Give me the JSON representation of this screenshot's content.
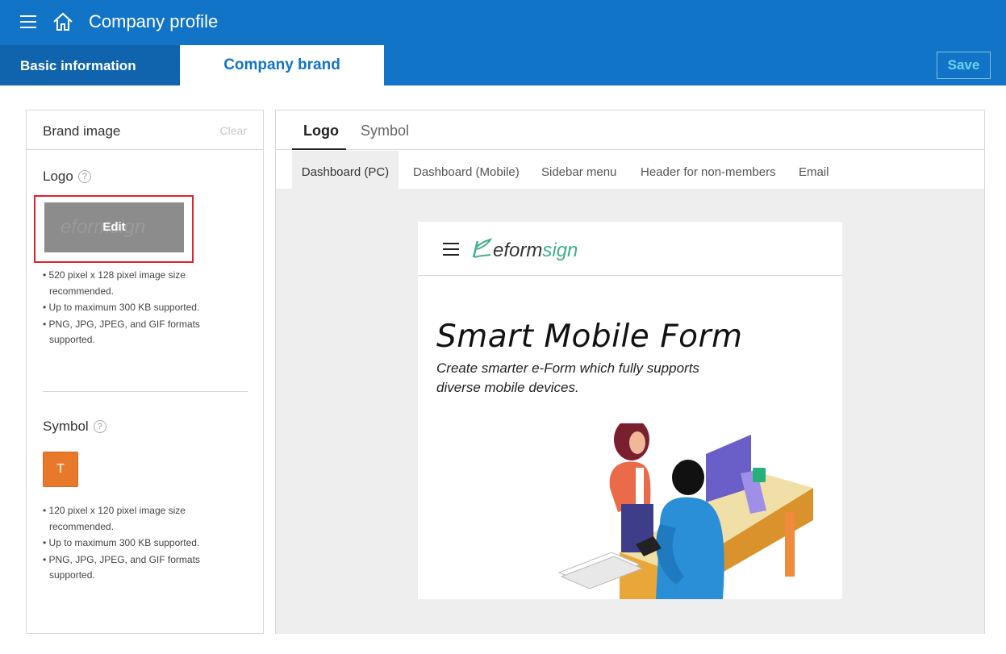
{
  "header": {
    "title": "Company profile"
  },
  "tabs": {
    "basic": "Basic information",
    "brand": "Company brand",
    "save": "Save"
  },
  "brand_panel": {
    "title": "Brand image",
    "clear": "Clear",
    "logo": {
      "label": "Logo",
      "help": "?",
      "edit": "Edit",
      "ghost_logo_text": "eformsign",
      "notes": [
        "• 520 pixel x 128 pixel image size recommended.",
        "• Up to maximum 300 KB supported.",
        "• PNG, JPG, JPEG, and GIF formats supported."
      ]
    },
    "symbol": {
      "label": "Symbol",
      "help": "?",
      "letter": "T",
      "notes": [
        "• 120 pixel x 120 pixel image size recommended.",
        "• Up to maximum 300 KB supported.",
        "• PNG, JPG, JPEG, and GIF formats supported."
      ]
    }
  },
  "preview_panel": {
    "tabs": [
      "Logo",
      "Symbol"
    ],
    "subtabs": [
      "Dashboard (PC)",
      "Dashboard (Mobile)",
      "Sidebar menu",
      "Header for non-members",
      "Email"
    ],
    "preview": {
      "logo_part1": "eform",
      "logo_part2": "sign",
      "headline": "Smart Mobile Form",
      "subline": "Create smarter e-Form which fully supports diverse mobile devices."
    }
  },
  "colors": {
    "primary": "#1274c6",
    "tab_dark": "#0f64ad",
    "highlight_border": "#e0202a",
    "symbol_bg": "#e8792b",
    "brand_green": "#3fae8b"
  },
  "icons": [
    "hamburger-menu-icon",
    "home-icon",
    "help-icon"
  ]
}
